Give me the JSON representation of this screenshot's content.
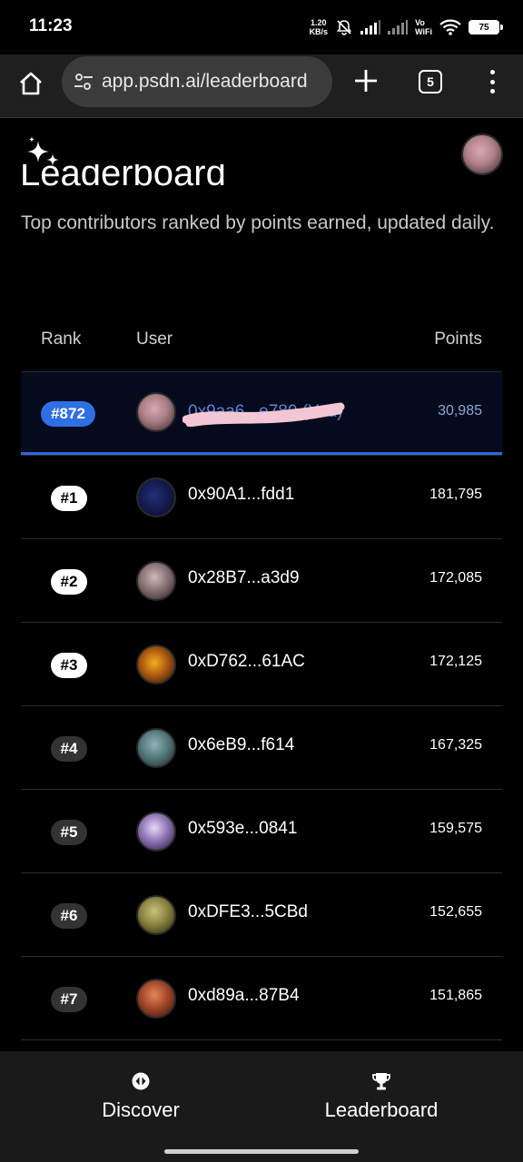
{
  "status_bar": {
    "time": "11:23",
    "net_speed_value": "1.20",
    "net_speed_unit": "KB/s",
    "volte": "Vo",
    "wifi_label": "WiFi",
    "battery": "75"
  },
  "browser": {
    "url": "app.psdn.ai/leaderboard",
    "tab_count": "5"
  },
  "page": {
    "title": "Leaderboard",
    "subtitle": "Top contributors ranked by points earned, updated daily."
  },
  "table": {
    "headers": {
      "rank": "Rank",
      "user": "User",
      "points": "Points"
    },
    "current_user": {
      "rank": "#872",
      "address": "0x9aa6...e780 (You)",
      "points": "30,985"
    },
    "rows": [
      {
        "rank": "#1",
        "address": "0x90A1...fdd1",
        "points": "181,795"
      },
      {
        "rank": "#2",
        "address": "0x28B7...a3d9",
        "points": "172,085"
      },
      {
        "rank": "#3",
        "address": "0xD762...61AC",
        "points": "172,125"
      },
      {
        "rank": "#4",
        "address": "0x6eB9...f614",
        "points": "167,325"
      },
      {
        "rank": "#5",
        "address": "0x593e...0841",
        "points": "159,575"
      },
      {
        "rank": "#6",
        "address": "0xDFE3...5CBd",
        "points": "152,655"
      },
      {
        "rank": "#7",
        "address": "0xd89a...87B4",
        "points": "151,865"
      }
    ]
  },
  "bottom_nav": {
    "discover": "Discover",
    "leaderboard": "Leaderboard"
  },
  "colors": {
    "accent_blue": "#2f6fe4",
    "highlight_row": "#050b1c",
    "background": "#000000"
  },
  "icons": [
    "home-icon",
    "tune-icon",
    "plus-icon",
    "tabs-icon",
    "more-vert-icon",
    "sparkle-icon",
    "compass-icon",
    "trophy-icon"
  ]
}
